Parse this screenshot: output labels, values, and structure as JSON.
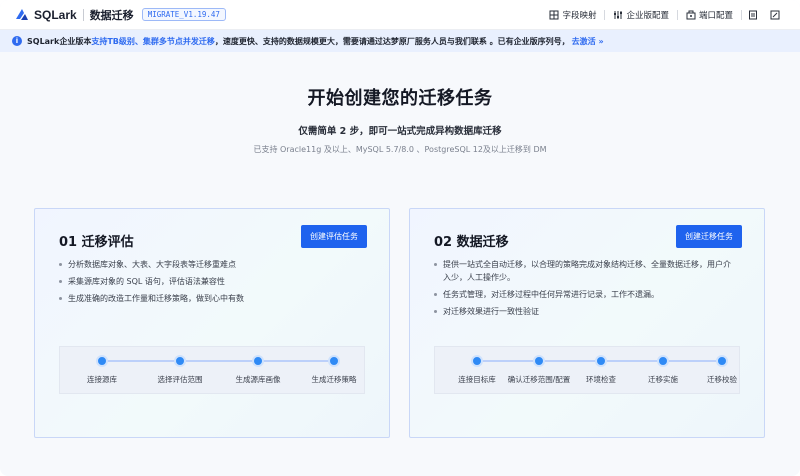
{
  "header": {
    "brand": "SQLark",
    "product": "数据迁移",
    "version": "MIGRATE_V1.19.47",
    "actions": [
      {
        "label": "字段映射",
        "icon": "field-mapping-icon"
      },
      {
        "label": "企业版配置",
        "icon": "enterprise-config-icon"
      },
      {
        "label": "端口配置",
        "icon": "port-config-icon"
      }
    ],
    "icon_buttons": [
      "document-icon",
      "edit-icon"
    ]
  },
  "notice": {
    "prefix": "SQLark企业版本",
    "highlight": "支持TB级别、集群多节点并发迁移",
    "middle": "，速度更快、支持的数据规模更大，需要请通过达梦原厂服务人员与我们联系 。已有企业版序列号，",
    "link": "去激活",
    "link_icon": "double-chevron-right-icon"
  },
  "hero": {
    "title": "开始创建您的迁移任务",
    "subtitle": "仅需简单 2 步，即可一站式完成异构数据库迁移",
    "support": "已支持 Oracle11g 及以上、MySQL 5.7/8.0 、PostgreSQL 12及以上迁移到 DM"
  },
  "cards": [
    {
      "title": "01 迁移评估",
      "button": "创建评估任务",
      "bullets": [
        "分析数据库对象、大表、大字段表等迁移重难点",
        "采集源库对象的 SQL 语句，评估语法兼容性",
        "生成准确的改造工作量和迁移策略，做到心中有数"
      ],
      "steps": [
        "连接源库",
        "选择评估范围",
        "生成源库画像",
        "生成迁移策略"
      ]
    },
    {
      "title": "02 数据迁移",
      "button": "创建迁移任务",
      "bullets": [
        "提供一站式全自动迁移，以合理的策略完成对象结构迁移、全量数据迁移，用户介入少，人工操作少。",
        "任务式管理，对迁移过程中任何异常进行记录，工作不遗漏。",
        "对迁移效果进行一致性验证"
      ],
      "steps": [
        "连接目标库",
        "确认迁移范围/配置",
        "环境检查",
        "迁移实施",
        "迁移校验"
      ]
    }
  ],
  "colors": {
    "accent": "#1f63ee",
    "step_dot": "#2f8af5",
    "notice_bg": "#e9f0fe"
  }
}
